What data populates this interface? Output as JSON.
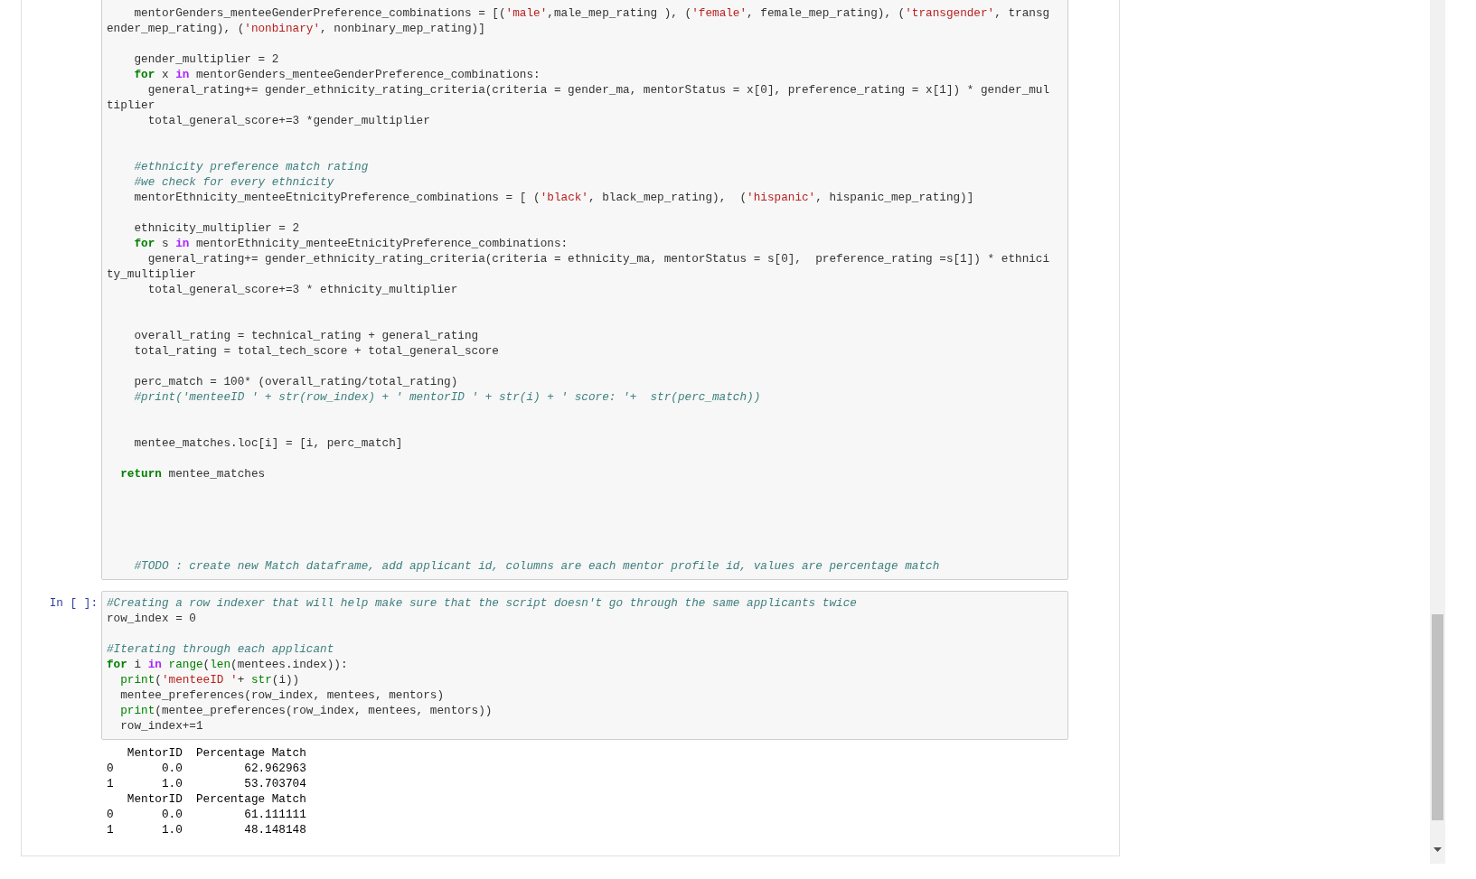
{
  "cells": [
    {
      "lines": [
        {
          "kind": "code",
          "segments": [
            {
              "kind": "plain",
              "text": "    mentorGenders_menteeGenderPreference_combinations = [("
            },
            {
              "kind": "string",
              "text": "'male'"
            },
            {
              "kind": "plain",
              "text": ",male_mep_rating ), ("
            },
            {
              "kind": "string",
              "text": "'female'"
            },
            {
              "kind": "plain",
              "text": ", female_mep_rating), ("
            },
            {
              "kind": "string",
              "text": "'transgender'"
            },
            {
              "kind": "plain",
              "text": ", transg"
            }
          ]
        },
        {
          "kind": "code",
          "segments": [
            {
              "kind": "plain",
              "text": "ender_mep_rating), ("
            },
            {
              "kind": "string",
              "text": "'nonbinary'"
            },
            {
              "kind": "plain",
              "text": ", nonbinary_mep_rating)]"
            }
          ]
        },
        {
          "kind": "blank"
        },
        {
          "kind": "code",
          "segments": [
            {
              "kind": "plain",
              "text": "    gender_multiplier = 2"
            }
          ]
        },
        {
          "kind": "code",
          "segments": [
            {
              "kind": "keyword",
              "text": "    for"
            },
            {
              "kind": "plain",
              "text": " x "
            },
            {
              "kind": "word_operator",
              "text": "in"
            },
            {
              "kind": "plain",
              "text": " mentorGenders_menteeGenderPreference_combinations:"
            }
          ]
        },
        {
          "kind": "code",
          "segments": [
            {
              "kind": "plain",
              "text": "      general_rating+= gender_ethnicity_rating_criteria(criteria = gender_ma, mentorStatus = x[0], preference_rating = x[1]) * gender_mul"
            }
          ]
        },
        {
          "kind": "code",
          "segments": [
            {
              "kind": "plain",
              "text": "tiplier"
            }
          ]
        },
        {
          "kind": "code",
          "segments": [
            {
              "kind": "plain",
              "text": "      total_general_score+=3 *gender_multiplier"
            }
          ]
        },
        {
          "kind": "blank"
        },
        {
          "kind": "blank"
        },
        {
          "kind": "code",
          "segments": [
            {
              "kind": "comment",
              "text": "    #ethnicity preference match rating"
            }
          ]
        },
        {
          "kind": "code",
          "segments": [
            {
              "kind": "comment",
              "text": "    #we check for every ethnicity"
            }
          ]
        },
        {
          "kind": "code",
          "segments": [
            {
              "kind": "plain",
              "text": "    mentorEthnicity_menteeEtnicityPreference_combinations = [ ("
            },
            {
              "kind": "string",
              "text": "'black'"
            },
            {
              "kind": "plain",
              "text": ", black_mep_rating),  ("
            },
            {
              "kind": "string",
              "text": "'hispanic'"
            },
            {
              "kind": "plain",
              "text": ", hispanic_mep_rating)]"
            }
          ]
        },
        {
          "kind": "blank"
        },
        {
          "kind": "code",
          "segments": [
            {
              "kind": "plain",
              "text": "    ethnicity_multiplier = 2"
            }
          ]
        },
        {
          "kind": "code",
          "segments": [
            {
              "kind": "keyword",
              "text": "    for"
            },
            {
              "kind": "plain",
              "text": " s "
            },
            {
              "kind": "word_operator",
              "text": "in"
            },
            {
              "kind": "plain",
              "text": " mentorEthnicity_menteeEtnicityPreference_combinations:"
            }
          ]
        },
        {
          "kind": "code",
          "segments": [
            {
              "kind": "plain",
              "text": "      general_rating+= gender_ethnicity_rating_criteria(criteria = ethnicity_ma, mentorStatus = s[0],  preference_rating =s[1]) * ethnici"
            }
          ]
        },
        {
          "kind": "code",
          "segments": [
            {
              "kind": "plain",
              "text": "ty_multiplier"
            }
          ]
        },
        {
          "kind": "code",
          "segments": [
            {
              "kind": "plain",
              "text": "      total_general_score+=3 * ethnicity_multiplier"
            }
          ]
        },
        {
          "kind": "blank"
        },
        {
          "kind": "blank"
        },
        {
          "kind": "code",
          "segments": [
            {
              "kind": "plain",
              "text": "    overall_rating = technical_rating + general_rating"
            }
          ]
        },
        {
          "kind": "code",
          "segments": [
            {
              "kind": "plain",
              "text": "    total_rating = total_tech_score + total_general_score"
            }
          ]
        },
        {
          "kind": "blank"
        },
        {
          "kind": "code",
          "segments": [
            {
              "kind": "plain",
              "text": "    perc_match = 100* (overall_rating/total_rating)"
            }
          ]
        },
        {
          "kind": "code",
          "segments": [
            {
              "kind": "comment",
              "text": "    #print('menteeID ' + str(row_index) + ' mentorID ' + str(i) + ' score: '+  str(perc_match))"
            }
          ]
        },
        {
          "kind": "blank"
        },
        {
          "kind": "blank"
        },
        {
          "kind": "code",
          "segments": [
            {
              "kind": "plain",
              "text": "    mentee_matches.loc[i] = [i, perc_match]"
            }
          ]
        },
        {
          "kind": "blank"
        },
        {
          "kind": "code",
          "segments": [
            {
              "kind": "keyword",
              "text": "  return"
            },
            {
              "kind": "plain",
              "text": " mentee_matches"
            }
          ]
        },
        {
          "kind": "blank"
        },
        {
          "kind": "blank"
        },
        {
          "kind": "blank"
        },
        {
          "kind": "blank"
        },
        {
          "kind": "blank"
        },
        {
          "kind": "code",
          "segments": [
            {
              "kind": "comment",
              "text": "    #TODO : create new Match dataframe, add applicant id, columns are each mentor profile id, values are percentage match"
            }
          ]
        }
      ]
    },
    {
      "prompt": "In [ ]:",
      "lines": [
        {
          "kind": "code",
          "segments": [
            {
              "kind": "comment",
              "text": "#Creating a row indexer that will help make sure that the script doesn't go through the same applicants twice"
            }
          ]
        },
        {
          "kind": "code",
          "segments": [
            {
              "kind": "plain",
              "text": "row_index = 0"
            }
          ]
        },
        {
          "kind": "blank"
        },
        {
          "kind": "code",
          "segments": [
            {
              "kind": "comment",
              "text": "#Iterating through each applicant"
            }
          ]
        },
        {
          "kind": "code",
          "segments": [
            {
              "kind": "keyword",
              "text": "for"
            },
            {
              "kind": "plain",
              "text": " i "
            },
            {
              "kind": "word_operator",
              "text": "in"
            },
            {
              "kind": "builtin",
              "text": " range"
            },
            {
              "kind": "plain",
              "text": "("
            },
            {
              "kind": "builtin",
              "text": "len"
            },
            {
              "kind": "plain",
              "text": "(mentees.index)):"
            }
          ]
        },
        {
          "kind": "code",
          "segments": [
            {
              "kind": "builtin",
              "text": "  print"
            },
            {
              "kind": "plain",
              "text": "("
            },
            {
              "kind": "string",
              "text": "'menteeID '"
            },
            {
              "kind": "plain",
              "text": "+ "
            },
            {
              "kind": "builtin",
              "text": "str"
            },
            {
              "kind": "plain",
              "text": "(i))"
            }
          ]
        },
        {
          "kind": "code",
          "segments": [
            {
              "kind": "plain",
              "text": "  mentee_preferences(row_index, mentees, mentors)"
            }
          ]
        },
        {
          "kind": "code",
          "segments": [
            {
              "kind": "builtin",
              "text": "  print"
            },
            {
              "kind": "plain",
              "text": "(mentee_preferences(row_index, mentees, mentors))"
            }
          ]
        },
        {
          "kind": "code",
          "segments": [
            {
              "kind": "plain",
              "text": "  row_index+=1"
            }
          ]
        }
      ],
      "output": [
        "   MentorID  Percentage Match",
        "0       0.0         62.962963",
        "1       1.0         53.703704",
        "   MentorID  Percentage Match",
        "0       0.0         61.111111",
        "1       1.0         48.148148"
      ]
    }
  ]
}
